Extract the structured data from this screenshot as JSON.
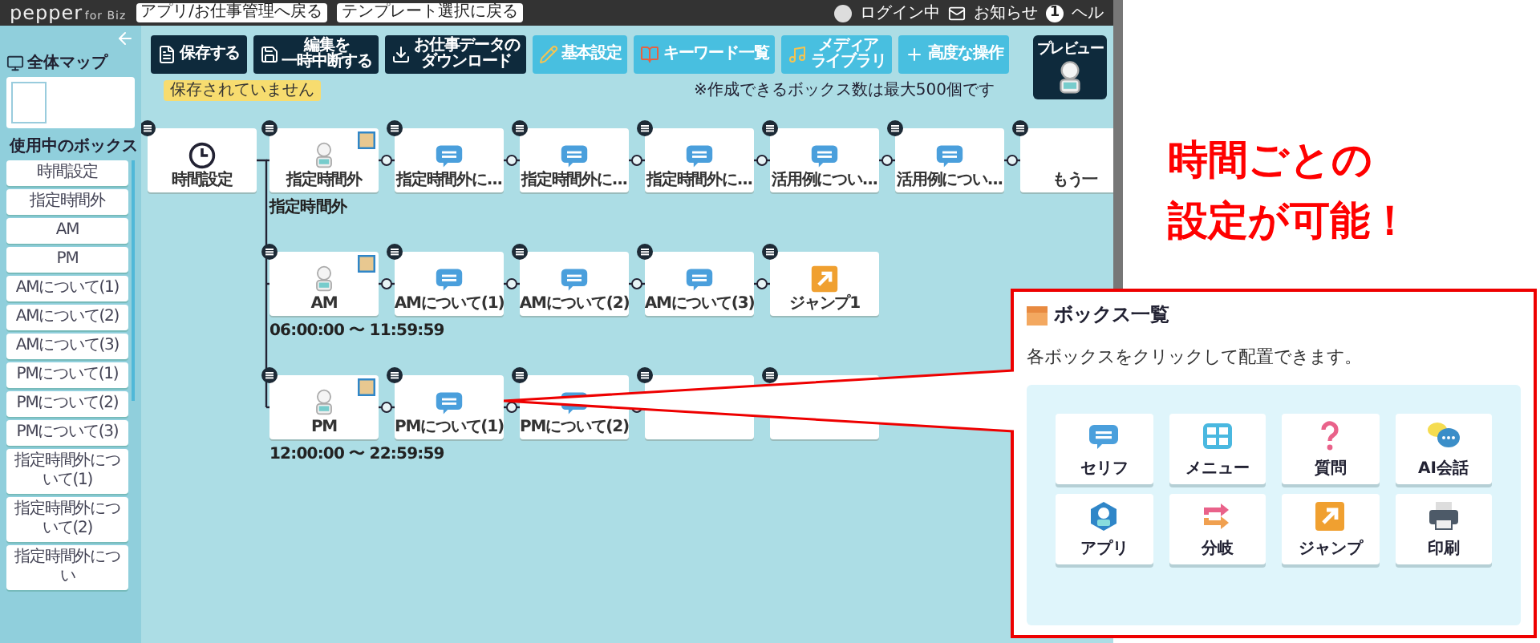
{
  "topbar": {
    "logo": "pepper",
    "logo_suffix": "for Biz",
    "links": [
      "アプリ/お仕事管理へ戻る",
      "テンプレート選択に戻る"
    ],
    "login": "ログイン中",
    "notice": "お知らせ",
    "notice_count": "1",
    "help": "ヘル"
  },
  "sidebar": {
    "map_title": "全体マップ",
    "boxes_title": "使用中のボックス",
    "items": [
      "時間設定",
      "指定時間外",
      "AM",
      "PM",
      "AMについて(1)",
      "AMについて(2)",
      "AMについて(3)",
      "PMについて(1)",
      "PMについて(2)",
      "PMについて(3)",
      "指定時間外について(1)",
      "指定時間外について(2)",
      "指定時間外につい"
    ]
  },
  "toolbar": [
    {
      "lines": [
        "保存する"
      ]
    },
    {
      "lines": [
        "編集を",
        "一時中断する"
      ]
    },
    {
      "lines": [
        "お仕事データの",
        "ダウンロード"
      ]
    },
    {
      "lines": [
        "基本設定"
      ]
    },
    {
      "lines": [
        "キーワード一覧"
      ]
    },
    {
      "lines": [
        "メディア",
        "ライブラリ"
      ]
    },
    {
      "lines": [
        "高度な操作"
      ]
    }
  ],
  "save_status": "保存されていません",
  "box_limit_note": "※作成できるボックス数は最大500個です",
  "preview": "プレビュー",
  "flow": {
    "root": {
      "kind": "time",
      "label": "時間設定"
    },
    "branches": [
      {
        "nodes": [
          {
            "kind": "app",
            "label": "指定時間外",
            "caption": "指定時間外"
          },
          {
            "kind": "chat",
            "label": "指定時間外に..."
          },
          {
            "kind": "chat",
            "label": "指定時間外に..."
          },
          {
            "kind": "chat",
            "label": "指定時間外に..."
          },
          {
            "kind": "chat",
            "label": "活用例につい..."
          },
          {
            "kind": "chat",
            "label": "活用例につい..."
          },
          {
            "kind": "blank",
            "label": "もう一"
          }
        ]
      },
      {
        "nodes": [
          {
            "kind": "app",
            "label": "AM",
            "caption": "06:00:00 〜 11:59:59"
          },
          {
            "kind": "chat",
            "label": "AMについて(1)"
          },
          {
            "kind": "chat",
            "label": "AMについて(2)"
          },
          {
            "kind": "chat",
            "label": "AMについて(3)"
          },
          {
            "kind": "jump",
            "label": "ジャンプ1"
          }
        ]
      },
      {
        "nodes": [
          {
            "kind": "app",
            "label": "PM",
            "caption": "12:00:00 〜 22:59:59"
          },
          {
            "kind": "chat",
            "label": "PMについて(1)"
          },
          {
            "kind": "chat",
            "label": "PMについて(2)"
          },
          {
            "kind": "blank"
          },
          {
            "kind": "blank"
          }
        ]
      }
    ]
  },
  "annotation": [
    "時間ごとの",
    "設定が可能！"
  ],
  "palette": {
    "title": "ボックス一覧",
    "description": "各ボックスをクリックして配置できます。",
    "items": [
      {
        "kind": "chat",
        "label": "セリフ"
      },
      {
        "kind": "menu",
        "label": "メニュー"
      },
      {
        "kind": "question",
        "label": "質問"
      },
      {
        "kind": "ai",
        "label": "AI会話"
      },
      {
        "kind": "app",
        "label": "アプリ"
      },
      {
        "kind": "branch",
        "label": "分岐"
      },
      {
        "kind": "jump",
        "label": "ジャンプ"
      },
      {
        "kind": "print",
        "label": "印刷"
      }
    ]
  }
}
